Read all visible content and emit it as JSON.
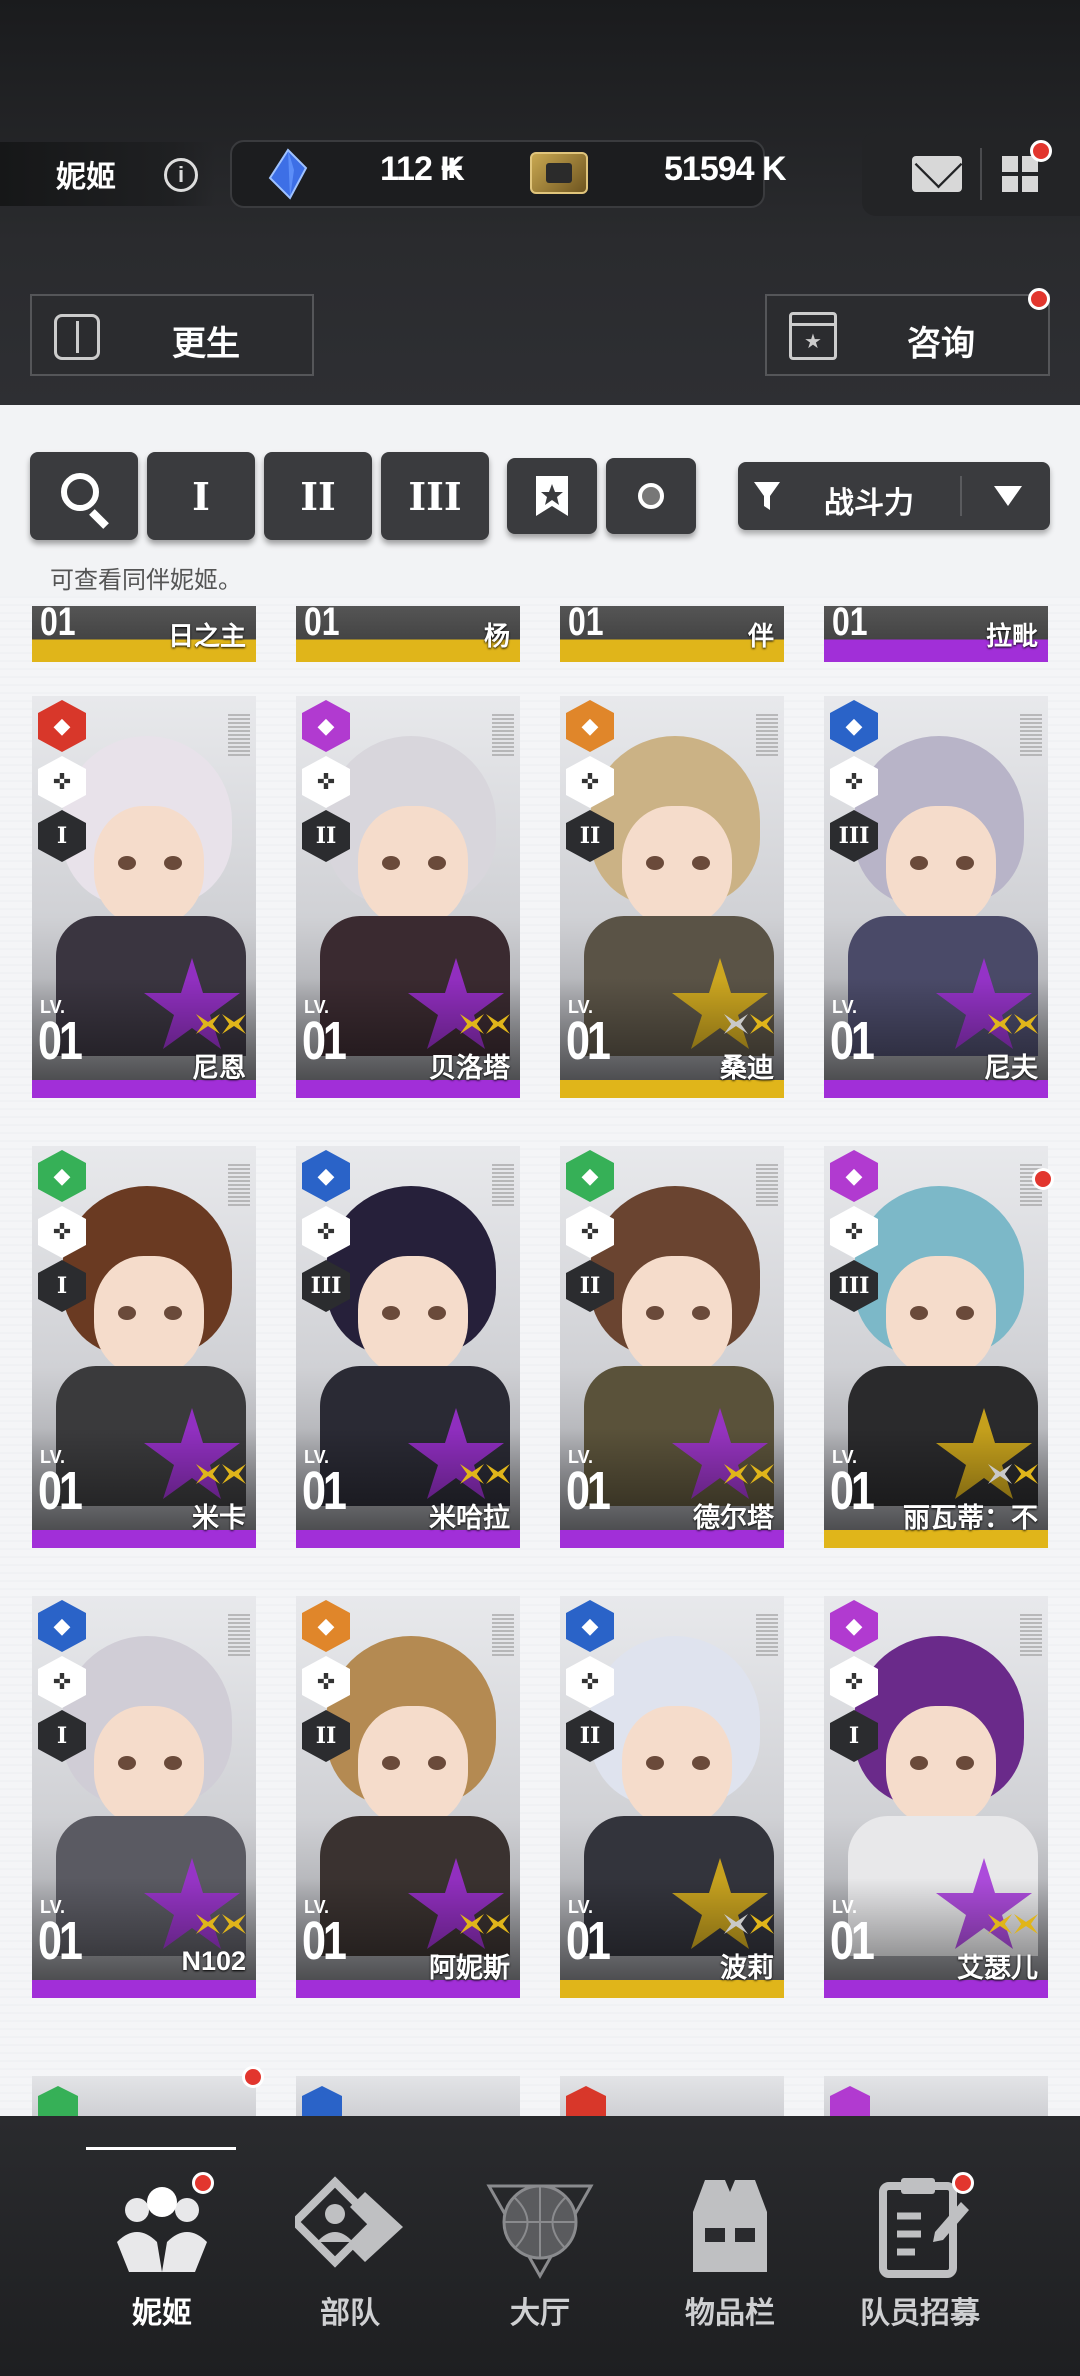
{
  "header": {
    "section_name": "妮姬",
    "info_glyph": "i",
    "currency": {
      "gem_value": "112 K",
      "gem_plus": "+",
      "credit_value": "51594 K"
    },
    "rebirth_button": "更生",
    "consult_button": "咨询"
  },
  "filters": {
    "burst_tabs": [
      "I",
      "II",
      "III"
    ],
    "sort_label": "战斗力",
    "hint": "可查看同伴妮姬。"
  },
  "partial_top_row": [
    {
      "lv": "01",
      "name": "日之主",
      "rarity": "SSR"
    },
    {
      "lv": "01",
      "name": "杨",
      "rarity": "SSR"
    },
    {
      "lv": "01",
      "name": "伴",
      "rarity": "SSR"
    },
    {
      "lv": "01",
      "name": "拉毗",
      "rarity": "SR"
    }
  ],
  "cards": [
    {
      "name": "尼恩",
      "lv_label": "LV.",
      "lv": "01",
      "element": "fire",
      "element_color": "#d8372a",
      "burst": "I",
      "rarity": "SR",
      "hair": "#e8e2ea",
      "outfit": "#3a3540"
    },
    {
      "name": "贝洛塔",
      "lv_label": "LV.",
      "lv": "01",
      "element": "electric",
      "element_color": "#b13ad0",
      "burst": "II",
      "rarity": "SR",
      "hair": "#d8d6dc",
      "outfit": "#3a2a30"
    },
    {
      "name": "桑迪",
      "lv_label": "LV.",
      "lv": "01",
      "element": "iron",
      "element_color": "#e0862a",
      "burst": "II",
      "rarity": "SSR",
      "hair": "#cbb285",
      "outfit": "#5a5346"
    },
    {
      "name": "尼夫",
      "lv_label": "LV.",
      "lv": "01",
      "element": "water",
      "element_color": "#2a63c8",
      "burst": "III",
      "rarity": "SR",
      "hair": "#b8b4c8",
      "outfit": "#4a4a68"
    },
    {
      "name": "米卡",
      "lv_label": "LV.",
      "lv": "01",
      "element": "wind",
      "element_color": "#36b057",
      "burst": "I",
      "rarity": "SR",
      "hair": "#6a3a22",
      "outfit": "#3a3a3c"
    },
    {
      "name": "米哈拉",
      "lv_label": "LV.",
      "lv": "01",
      "element": "water",
      "element_color": "#2a63c8",
      "burst": "III",
      "rarity": "SR",
      "hair": "#26203a",
      "outfit": "#2a2a34"
    },
    {
      "name": "德尔塔",
      "lv_label": "LV.",
      "lv": "01",
      "element": "wind",
      "element_color": "#36b057",
      "burst": "II",
      "rarity": "SR",
      "hair": "#6a4430",
      "outfit": "#5a523a"
    },
    {
      "name": "丽瓦蒂：不",
      "lv_label": "LV.",
      "lv": "01",
      "element": "electric",
      "element_color": "#b13ad0",
      "burst": "III",
      "rarity": "SSR",
      "hair": "#7cb8c8",
      "outfit": "#2a2a2c"
    },
    {
      "name": "N102",
      "lv_label": "LV.",
      "lv": "01",
      "element": "water",
      "element_color": "#2a63c8",
      "burst": "I",
      "rarity": "SR",
      "hair": "#d0cdd6",
      "outfit": "#5a5a62"
    },
    {
      "name": "阿妮斯",
      "lv_label": "LV.",
      "lv": "01",
      "element": "iron",
      "element_color": "#e0862a",
      "burst": "II",
      "rarity": "SR",
      "hair": "#b48a52",
      "outfit": "#3a3230"
    },
    {
      "name": "波莉",
      "lv_label": "LV.",
      "lv": "01",
      "element": "water",
      "element_color": "#2a63c8",
      "burst": "II",
      "rarity": "SSR",
      "hair": "#dfe3ee",
      "outfit": "#33343c"
    },
    {
      "name": "艾瑟儿",
      "lv_label": "LV.",
      "lv": "01",
      "element": "electric",
      "element_color": "#b13ad0",
      "burst": "I",
      "rarity": "SR",
      "hair": "#6a2a8a",
      "outfit": "#e8e8ea"
    }
  ],
  "colors": {
    "sr": "#a12fd8",
    "ssr": "#e0b51a",
    "notify": "#e2362e"
  },
  "nav": [
    {
      "label": "妮姬",
      "active": true
    },
    {
      "label": "部队",
      "active": false
    },
    {
      "label": "大厅",
      "active": false
    },
    {
      "label": "物品栏",
      "active": false
    },
    {
      "label": "队员招募",
      "active": false
    }
  ]
}
